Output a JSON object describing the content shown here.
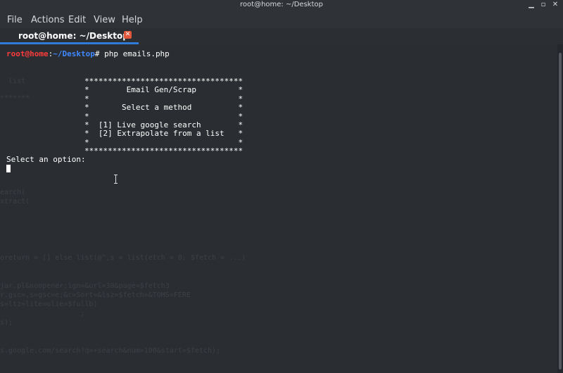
{
  "window": {
    "title": "root@home: ~/Desktop"
  },
  "menu": {
    "items": [
      "File",
      "Actions",
      "Edit",
      "View",
      "Help"
    ]
  },
  "tab": {
    "label": "root@home: ~/Desktop"
  },
  "terminal": {
    "prompt_user": "root@home",
    "prompt_sep": ":",
    "prompt_path": "~/Desktop",
    "prompt_symbol": "#",
    "command": " php emails.php",
    "banner": [
      "**********************************",
      "*        Email Gen/Scrap         *",
      "*                                *",
      "*       Select a method          *",
      "*                                *",
      "*  [1] Live google search        *",
      "*  [2] Extrapolate from a list   *",
      "*                                *",
      "**********************************"
    ],
    "select_prompt": "Select an option:"
  },
  "icons": {
    "close": "close-icon",
    "minimize": "minimize-icon",
    "maximize": "maximize-icon",
    "tab_close": "tab-close-icon",
    "cursor": "text-cursor-icon"
  }
}
